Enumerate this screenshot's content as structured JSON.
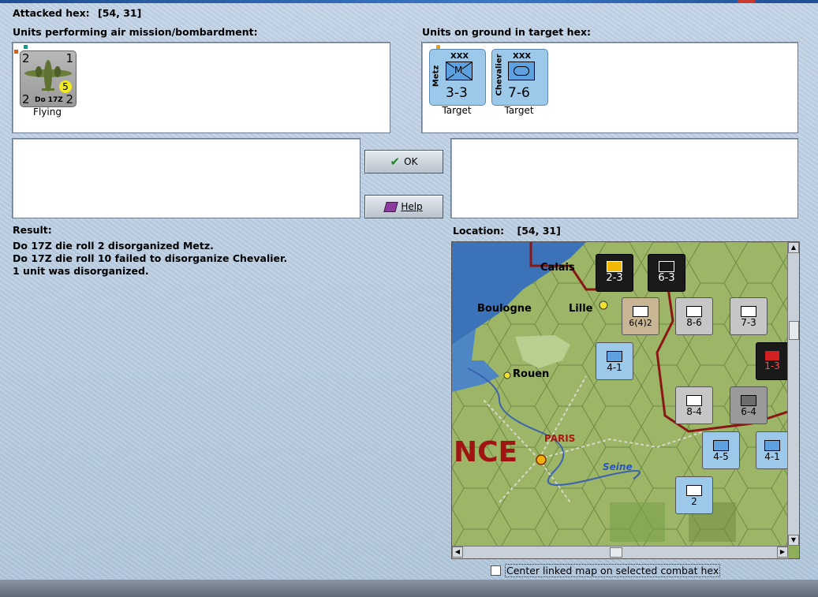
{
  "header": {
    "attacked_label": "Attacked hex:",
    "attacked_hex": "[54, 31]"
  },
  "left_panel": {
    "title": "Units performing air mission/bombardment:",
    "units": [
      {
        "name": "Do 17Z",
        "top_left": "2",
        "top_right": "1",
        "bottom_left": "2",
        "bottom_right": "2",
        "badge": "5",
        "status": "Flying"
      }
    ]
  },
  "right_panel": {
    "title": "Units on ground in target hex:",
    "units": [
      {
        "name": "Metz",
        "size": "XXX",
        "symbol": "M",
        "strength": "3-3",
        "status": "Target"
      },
      {
        "name": "Chevalier",
        "size": "XXX",
        "symbol": "",
        "strength": "7-6",
        "status": "Target"
      }
    ]
  },
  "buttons": {
    "ok": "OK",
    "help": "Help"
  },
  "result": {
    "label": "Result:",
    "lines": [
      "Do 17Z die roll 2 disorganized Metz.",
      "Do 17Z die roll 10 failed to disorganize Chevalier.",
      "1 unit was disorganized."
    ]
  },
  "location": {
    "label": "Location:",
    "hex": "[54, 31]"
  },
  "map": {
    "places": [
      "Calais",
      "Boulogne",
      "Lille",
      "Rouen",
      "PARIS",
      "Seine",
      "NCE"
    ],
    "counters": [
      {
        "label": "2-3"
      },
      {
        "label": "6-3"
      },
      {
        "label": "6(4)2"
      },
      {
        "label": "8-6"
      },
      {
        "label": "7-3"
      },
      {
        "label": "4-1"
      },
      {
        "label": "1-3"
      },
      {
        "label": "8-4"
      },
      {
        "label": "6-4"
      },
      {
        "label": "4-5"
      },
      {
        "label": "4-1"
      },
      {
        "label": "2"
      }
    ]
  },
  "center_option": {
    "label": "Center linked map on selected combat hex",
    "checked": false
  },
  "colors": {
    "background": "#b9cde0",
    "counter_blue": "#9cc8ea",
    "result_red": "#b31414"
  }
}
